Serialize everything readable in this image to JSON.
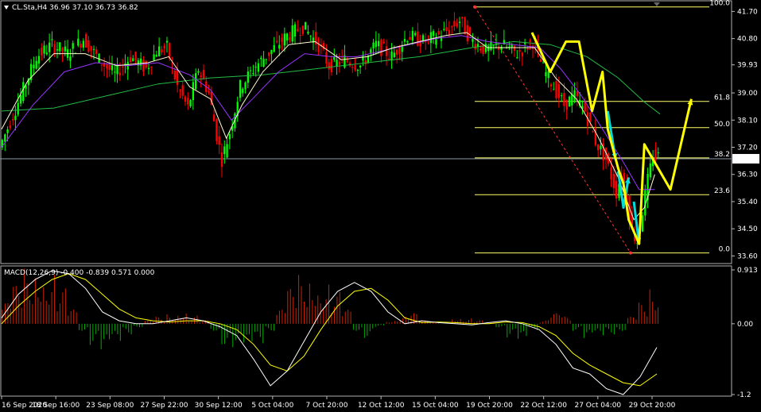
{
  "header": {
    "main_title": "CL.Sta,H4  36.96 37.10 36.73 36.82",
    "macd_title": "MACD(12,26,9) -0.400 -0.839 0.571 0.000"
  },
  "colors": {
    "background": "#000000",
    "bull_candle": "#00ff00",
    "bear_candle": "#ff0000",
    "ma_fast": "#ffff00",
    "ma_mid": "#9933ff",
    "ma_slow": "#22bb44",
    "fib": "#ffff66",
    "arrow_yellow": "#ffff00",
    "arrow_cyan": "#00dddd",
    "macd_pos": "#cc2200",
    "macd_neg": "#00aa00",
    "macd_line": "#ffffff",
    "signal_line": "#ffff00",
    "current_price_line": "#8899aa"
  },
  "chart_data": [
    {
      "type": "candlestick",
      "title": "CL.Sta,H4",
      "ohlc_last": {
        "open": 36.96,
        "high": 37.1,
        "low": 36.73,
        "close": 36.82
      },
      "current_price": "36.82",
      "ylim": [
        33.4,
        42.0
      ],
      "y_ticks": [
        "41.70",
        "40.80",
        "39.93",
        "39.00",
        "38.10",
        "37.20",
        "36.30",
        "35.40",
        "34.50",
        "33.60"
      ],
      "x_ticks": [
        "16 Sep 2020",
        "18 Sep 16:00",
        "23 Sep 08:00",
        "27 Sep 22:00",
        "30 Sep 12:00",
        "5 Oct 04:00",
        "7 Oct 20:00",
        "12 Oct 12:00",
        "15 Oct 04:00",
        "19 Oct 20:00",
        "22 Oct 12:00",
        "27 Oct 04:00",
        "29 Oct 20:00"
      ],
      "price_path": [
        [
          0,
          37.2
        ],
        [
          8,
          38.9
        ],
        [
          14,
          40.2
        ],
        [
          20,
          40.6
        ],
        [
          26,
          40.3
        ],
        [
          32,
          40.8
        ],
        [
          38,
          40.1
        ],
        [
          44,
          39.6
        ],
        [
          50,
          40.2
        ],
        [
          56,
          39.8
        ],
        [
          60,
          40.4
        ],
        [
          64,
          40.5
        ],
        [
          68,
          39.2
        ],
        [
          72,
          38.5
        ],
        [
          76,
          39.8
        ],
        [
          80,
          39.0
        ],
        [
          83,
          37.6
        ],
        [
          85,
          36.8
        ],
        [
          88,
          37.7
        ],
        [
          92,
          39.2
        ],
        [
          98,
          39.9
        ],
        [
          104,
          40.4
        ],
        [
          110,
          40.9
        ],
        [
          116,
          41.2
        ],
        [
          122,
          40.6
        ],
        [
          126,
          39.9
        ],
        [
          132,
          40.1
        ],
        [
          138,
          39.9
        ],
        [
          144,
          40.6
        ],
        [
          150,
          40.2
        ],
        [
          156,
          40.9
        ],
        [
          162,
          40.7
        ],
        [
          168,
          40.9
        ],
        [
          172,
          41.1
        ],
        [
          176,
          41.4
        ],
        [
          180,
          40.8
        ],
        [
          186,
          40.4
        ],
        [
          192,
          40.6
        ],
        [
          198,
          40.3
        ],
        [
          204,
          40.7
        ],
        [
          208,
          39.8
        ],
        [
          212,
          39.2
        ],
        [
          216,
          38.6
        ],
        [
          220,
          38.9
        ],
        [
          224,
          38.4
        ],
        [
          228,
          37.4
        ],
        [
          232,
          36.8
        ],
        [
          236,
          35.7
        ],
        [
          238,
          36.4
        ],
        [
          240,
          35.6
        ],
        [
          242,
          34.4
        ],
        [
          244,
          34.1
        ],
        [
          246,
          35.1
        ],
        [
          248,
          36.1
        ],
        [
          250,
          36.9
        ]
      ],
      "ma_fast_path": [
        [
          0,
          37.8
        ],
        [
          10,
          39.4
        ],
        [
          20,
          40.3
        ],
        [
          32,
          40.3
        ],
        [
          44,
          39.9
        ],
        [
          56,
          40.0
        ],
        [
          64,
          40.2
        ],
        [
          72,
          39.2
        ],
        [
          80,
          38.8
        ],
        [
          86,
          37.5
        ],
        [
          92,
          38.6
        ],
        [
          100,
          39.7
        ],
        [
          110,
          40.6
        ],
        [
          120,
          40.7
        ],
        [
          130,
          40.1
        ],
        [
          140,
          40.2
        ],
        [
          150,
          40.5
        ],
        [
          160,
          40.7
        ],
        [
          170,
          40.9
        ],
        [
          178,
          41.0
        ],
        [
          186,
          40.5
        ],
        [
          196,
          40.5
        ],
        [
          204,
          40.5
        ],
        [
          212,
          39.5
        ],
        [
          220,
          38.8
        ],
        [
          228,
          37.6
        ],
        [
          236,
          36.2
        ],
        [
          242,
          34.8
        ],
        [
          246,
          35.2
        ],
        [
          250,
          36.3
        ]
      ],
      "ma_mid_path": [
        [
          0,
          37.2
        ],
        [
          12,
          38.6
        ],
        [
          24,
          39.7
        ],
        [
          36,
          40.0
        ],
        [
          48,
          39.9
        ],
        [
          60,
          40.0
        ],
        [
          72,
          39.6
        ],
        [
          80,
          39.1
        ],
        [
          88,
          38.1
        ],
        [
          96,
          38.8
        ],
        [
          106,
          39.7
        ],
        [
          116,
          40.3
        ],
        [
          126,
          40.2
        ],
        [
          136,
          40.2
        ],
        [
          146,
          40.4
        ],
        [
          156,
          40.6
        ],
        [
          166,
          40.8
        ],
        [
          176,
          40.9
        ],
        [
          186,
          40.7
        ],
        [
          196,
          40.6
        ],
        [
          206,
          40.5
        ],
        [
          214,
          39.8
        ],
        [
          222,
          38.9
        ],
        [
          230,
          37.8
        ],
        [
          238,
          36.7
        ],
        [
          244,
          35.8
        ],
        [
          250,
          35.8
        ]
      ],
      "ma_slow_path": [
        [
          0,
          38.4
        ],
        [
          20,
          38.5
        ],
        [
          40,
          38.9
        ],
        [
          60,
          39.3
        ],
        [
          80,
          39.5
        ],
        [
          100,
          39.6
        ],
        [
          120,
          39.8
        ],
        [
          140,
          40.0
        ],
        [
          160,
          40.2
        ],
        [
          180,
          40.5
        ],
        [
          196,
          40.7
        ],
        [
          210,
          40.6
        ],
        [
          224,
          40.2
        ],
        [
          236,
          39.5
        ],
        [
          246,
          38.7
        ],
        [
          252,
          38.3
        ]
      ],
      "fib_levels": [
        {
          "label": "100.0",
          "price": 41.85
        },
        {
          "label": "61.8",
          "price": 38.72
        },
        {
          "label": "50.0",
          "price": 37.85
        },
        {
          "label": "38.2",
          "price": 36.85
        },
        {
          "label": "23.6",
          "price": 35.63
        },
        {
          "label": "0.0",
          "price": 33.7
        }
      ],
      "yellow_arrows": [
        [
          [
            203,
            41.0
          ],
          [
            210,
            39.7
          ],
          [
            216,
            40.7
          ],
          [
            221,
            40.7
          ],
          [
            226,
            38.4
          ],
          [
            230,
            39.7
          ],
          [
            232,
            37.8
          ],
          [
            236,
            36.5
          ],
          [
            238,
            36.0
          ],
          [
            240,
            34.8
          ],
          [
            244,
            34.0
          ],
          [
            246,
            37.3
          ],
          [
            256,
            35.8
          ],
          [
            264,
            38.8
          ]
        ]
      ],
      "cyan_arrows": [
        [
          [
            232,
            38.4
          ],
          [
            235,
            36.8
          ]
        ],
        [
          [
            236,
            36.4
          ],
          [
            238,
            35.2
          ],
          [
            240,
            36.2
          ]
        ],
        [
          [
            242,
            35.4
          ],
          [
            244,
            34.0
          ]
        ]
      ]
    },
    {
      "type": "bar",
      "title": "MACD(12,26,9)",
      "values_last": {
        "macd": -0.4,
        "signal": -0.839,
        "hist": 0.571,
        "extra": 0.0
      },
      "ylim": [
        -1.2,
        0.913
      ],
      "y_ticks": [
        "0.913",
        "0.00",
        "-1.2"
      ],
      "histogram": [
        0.3,
        0.55,
        0.8,
        0.9,
        0.78,
        0.5,
        0.2,
        -0.1,
        -0.3,
        -0.45,
        -0.3,
        -0.15,
        -0.05,
        0.05,
        0.1,
        0.15,
        0.2,
        0.12,
        0.05,
        -0.1,
        -0.3,
        -0.35,
        -0.4,
        -0.3,
        -0.1,
        0.2,
        0.5,
        0.7,
        0.75,
        0.65,
        0.45,
        0.2,
        -0.1,
        -0.2,
        -0.05,
        0.05,
        0.1,
        0.15,
        0.05,
        0.02,
        0.0,
        0.1,
        0.08,
        0.05,
        0.02,
        -0.05,
        -0.2,
        -0.3,
        -0.1,
        0.05,
        0.15,
        0.1,
        -0.1,
        -0.25,
        -0.2,
        -0.15,
        -0.1,
        0.1,
        0.3,
        0.55
      ],
      "macd_line": [
        0.1,
        0.5,
        0.75,
        0.9,
        0.85,
        0.6,
        0.2,
        0.05,
        0.0,
        0.0,
        0.05,
        0.1,
        0.05,
        -0.05,
        -0.2,
        -0.6,
        -1.05,
        -0.8,
        -0.3,
        0.2,
        0.55,
        0.7,
        0.55,
        0.2,
        0.0,
        0.05,
        0.02,
        0.0,
        -0.02,
        0.02,
        0.05,
        0.0,
        -0.1,
        -0.35,
        -0.75,
        -0.85,
        -1.1,
        -1.2,
        -0.9,
        -0.4
      ],
      "signal_line": [
        0.0,
        0.3,
        0.55,
        0.75,
        0.85,
        0.75,
        0.5,
        0.25,
        0.1,
        0.05,
        0.03,
        0.05,
        0.05,
        0.0,
        -0.1,
        -0.35,
        -0.7,
        -0.8,
        -0.55,
        -0.1,
        0.3,
        0.55,
        0.6,
        0.4,
        0.1,
        0.02,
        0.03,
        0.02,
        0.0,
        0.0,
        0.03,
        0.02,
        -0.05,
        -0.2,
        -0.5,
        -0.7,
        -0.85,
        -1.0,
        -1.05,
        -0.85
      ]
    }
  ]
}
